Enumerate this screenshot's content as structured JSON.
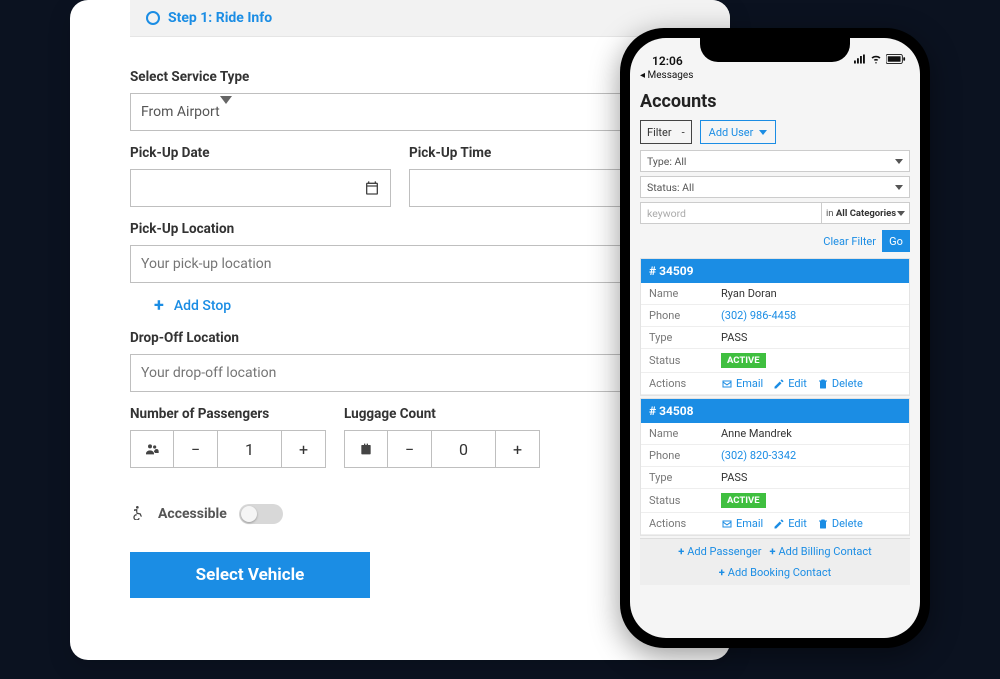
{
  "form": {
    "step_title": "Step 1: Ride Info",
    "service_type_label": "Select Service Type",
    "service_type_value": "From Airport",
    "pickup_date_label": "Pick-Up Date",
    "pickup_time_label": "Pick-Up Time",
    "pickup_location_label": "Pick-Up Location",
    "pickup_location_placeholder": "Your pick-up location",
    "add_stop_label": "Add Stop",
    "dropoff_label": "Drop-Off Location",
    "dropoff_placeholder": "Your drop-off location",
    "passengers_label": "Number of Passengers",
    "passengers_value": "1",
    "luggage_label": "Luggage Count",
    "luggage_value": "0",
    "accessible_label": "Accessible",
    "submit_label": "Select Vehicle"
  },
  "phone": {
    "time": "12:06",
    "back": "Messages",
    "title": "Accounts",
    "filter_label": "Filter",
    "add_user_label": "Add User",
    "type_sel": "Type: All",
    "status_sel": "Status: All",
    "keyword_placeholder": "keyword",
    "in_label": "in",
    "categories": "All Categories",
    "clear_label": "Clear Filter",
    "go_label": "Go",
    "cards": [
      {
        "id": "# 34509",
        "name": "Ryan Doran",
        "phone": "(302) 986-4458",
        "type": "PASS",
        "status": "ACTIVE"
      },
      {
        "id": "# 34508",
        "name": "Anne Mandrek",
        "phone": "(302) 820-3342",
        "type": "PASS",
        "status": "ACTIVE"
      }
    ],
    "row_labels": {
      "name": "Name",
      "phone": "Phone",
      "type": "Type",
      "status": "Status",
      "actions": "Actions"
    },
    "action_email": "Email",
    "action_edit": "Edit",
    "action_delete": "Delete",
    "bottom": {
      "add_passenger": "Add Passenger",
      "add_billing": "Add Billing Contact",
      "add_booking": "Add Booking Contact"
    }
  }
}
